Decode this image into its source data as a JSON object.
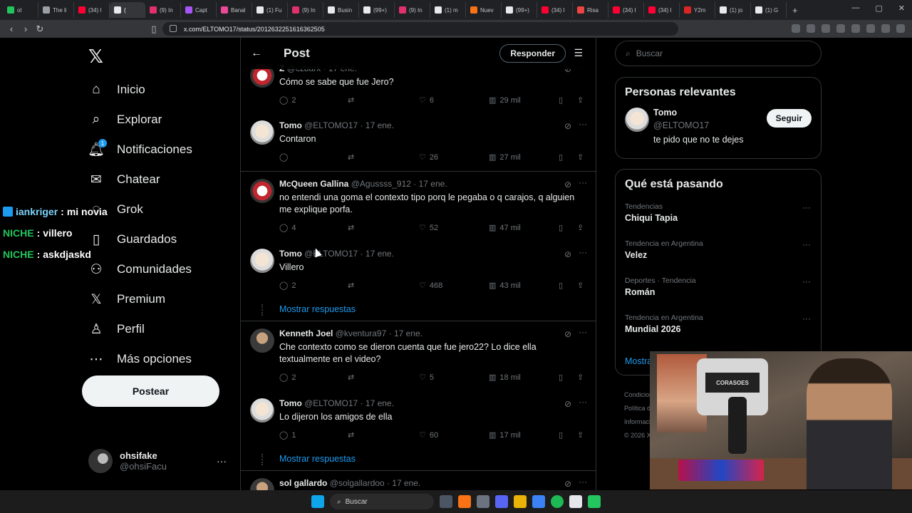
{
  "browser": {
    "tabs": [
      {
        "label": "ol",
        "color": "#22c55e"
      },
      {
        "label": "The li",
        "color": "#9aa0a6"
      },
      {
        "label": "(34) I",
        "color": "#ff0033"
      },
      {
        "label": "(",
        "color": "#e7e9ea",
        "active": true
      },
      {
        "label": "(9) In",
        "color": "#e1306c"
      },
      {
        "label": "Capt",
        "color": "#a855f7"
      },
      {
        "label": "Banal",
        "color": "#ec4899"
      },
      {
        "label": "(1) Fu",
        "color": "#e7e9ea"
      },
      {
        "label": "(9) In",
        "color": "#e1306c"
      },
      {
        "label": "Busin",
        "color": "#e7e9ea"
      },
      {
        "label": "(99+)",
        "color": "#e7e9ea"
      },
      {
        "label": "(9) In",
        "color": "#e1306c"
      },
      {
        "label": "(1) m",
        "color": "#e7e9ea"
      },
      {
        "label": "Nuev",
        "color": "#f97316"
      },
      {
        "label": "(99+)",
        "color": "#e7e9ea"
      },
      {
        "label": "(34) I",
        "color": "#ff0033"
      },
      {
        "label": "Risa",
        "color": "#ef4444"
      },
      {
        "label": "(34) I",
        "color": "#ff0033"
      },
      {
        "label": "(34) I",
        "color": "#ff0033"
      },
      {
        "label": "Y2m",
        "color": "#dc2626"
      },
      {
        "label": "(1) jo",
        "color": "#e7e9ea"
      },
      {
        "label": "(1) G",
        "color": "#e7e9ea"
      }
    ],
    "new_tab": "+",
    "url": "x.com/ELTOMO17/status/2012632251616362505"
  },
  "sidebar": {
    "logo": "𝕏",
    "items": [
      {
        "label": "Inicio",
        "icon": "⌂",
        "name": "home"
      },
      {
        "label": "Explorar",
        "icon": "⌕",
        "name": "explore"
      },
      {
        "label": "Notificaciones",
        "icon": "🔔︎",
        "name": "notifications",
        "badge": "1"
      },
      {
        "label": "Chatear",
        "icon": "✉",
        "name": "chat"
      },
      {
        "label": "Grok",
        "icon": "◌",
        "name": "grok"
      },
      {
        "label": "Guardados",
        "icon": "▯",
        "name": "bookmarks"
      },
      {
        "label": "Comunidades",
        "icon": "⚇",
        "name": "communities"
      },
      {
        "label": "Premium",
        "icon": "𝕏",
        "name": "premium"
      },
      {
        "label": "Perfil",
        "icon": "♙",
        "name": "profile"
      },
      {
        "label": "Más opciones",
        "icon": "⋯",
        "name": "more"
      }
    ],
    "post_label": "Postear",
    "account": {
      "name": "ohsifake",
      "handle": "@ohsiFacu",
      "more": "···"
    }
  },
  "overlay_chat": [
    {
      "user": "iankriger",
      "msg": "mi novia",
      "style": "blue"
    },
    {
      "user": "NICHE",
      "msg": "villero",
      "style": "green"
    },
    {
      "user": "NICHE",
      "msg": "askdjaskd",
      "style": "green"
    }
  ],
  "center": {
    "title": "Post",
    "reply_label": "Responder",
    "show_replies": "Mostrar respuestas",
    "tweets": [
      {
        "name": "Z",
        "handle": "@czbarx",
        "date": "17 ene.",
        "text": "Cómo se sabe que fue Jero?",
        "replies": "2",
        "likes": "6",
        "views": "29 mil",
        "avatar": "red"
      },
      {
        "name": "Tomo",
        "handle": "@ELTOMO17",
        "date": "17 ene.",
        "text": "Contaron",
        "replies": "",
        "likes": "26",
        "views": "27 mil",
        "avatar": "tomo"
      },
      {
        "name": "McQueen Gallina",
        "handle": "@Agussss_912",
        "date": "17 ene.",
        "text": "no entendi una goma el contexto tipo porq le pegaba o q carajos, q alguien me explique porfa.",
        "replies": "4",
        "likes": "52",
        "views": "47 mil",
        "avatar": "red"
      },
      {
        "name": "Tomo",
        "handle": "@ELTOMO17",
        "date": "17 ene.",
        "text": "Villero",
        "replies": "2",
        "likes": "468",
        "views": "43 mil",
        "avatar": "tomo"
      },
      {
        "name": "Kenneth Joel",
        "handle": "@kventura97",
        "date": "17 ene.",
        "text": "Che contexto como se dieron cuenta que fue jero22? Lo dice ella textualmente en el video?",
        "replies": "2",
        "likes": "5",
        "views": "18 mil",
        "avatar": "kj"
      },
      {
        "name": "Tomo",
        "handle": "@ELTOMO17",
        "date": "17 ene.",
        "text": "Lo dijeron los amigos de ella",
        "replies": "1",
        "likes": "60",
        "views": "17 mil",
        "avatar": "tomo"
      },
      {
        "name": "sol gallardo",
        "handle": "@solgallardoo",
        "date": "17 ene.",
        "text": "",
        "replies": "",
        "likes": "",
        "views": "",
        "avatar": "kj"
      }
    ]
  },
  "right": {
    "search_placeholder": "Buscar",
    "relevant_title": "Personas relevantes",
    "relevant_user": {
      "name": "Tomo",
      "handle": "@ELTOMO17",
      "bio": "te pido que no te dejes",
      "follow": "Seguir"
    },
    "trending_title": "Qué está pasando",
    "trends": [
      {
        "context": "Tendencias",
        "name": "Chiqui Tapia"
      },
      {
        "context": "Tendencia en Argentina",
        "name": "Velez"
      },
      {
        "context": "Deportes · Tendencia",
        "name": "Román"
      },
      {
        "context": "Tendencia en Argentina",
        "name": "Mundial 2026"
      }
    ],
    "show_more": "Mostrar más",
    "footer": [
      "Condiciones",
      "Política de",
      "Informació",
      "© 2026 X"
    ]
  },
  "webcam": {
    "shirt_text": "CORASOES"
  },
  "taskbar": {
    "search": "Buscar"
  },
  "colors": {
    "accent": "#1d9bf0",
    "bg": "#000000",
    "border": "#2f3336",
    "muted": "#71767b"
  }
}
